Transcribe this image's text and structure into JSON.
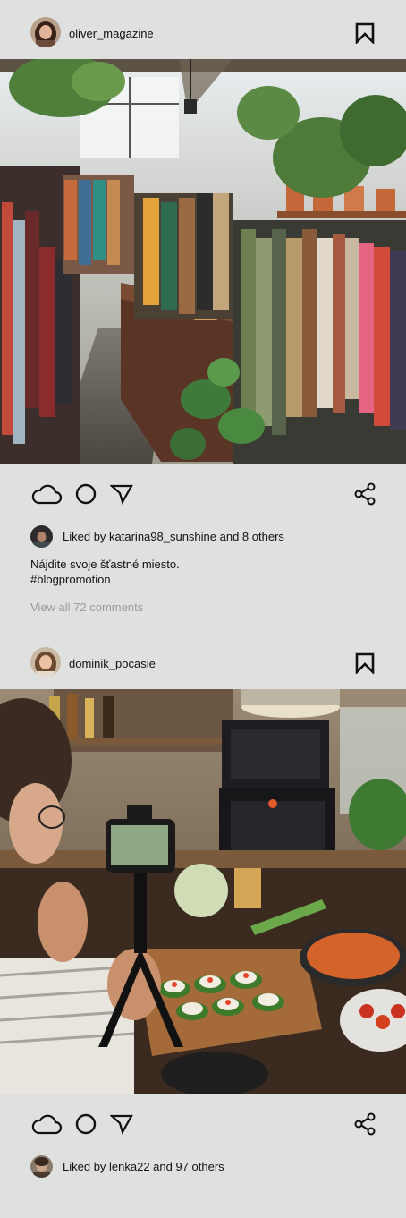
{
  "posts": [
    {
      "username": "oliver_magazine",
      "photo_subject": "vintage-clothing-shop-with-plants",
      "likes_text": "Liked by katarina98_sunshine and 8 others",
      "caption_line1": "Nájdite svoje šťastné miesto.",
      "caption_line2": "#blogpromotion",
      "view_comments": "View all 72 comments"
    },
    {
      "username": "dominik_pocasie",
      "photo_subject": "person-filming-food-spread-with-camera",
      "likes_text": "Liked by lenka22 and 97 others"
    }
  ],
  "icons": {
    "bookmark": "bookmark-icon",
    "like": "cloud-icon",
    "comment": "circle-icon",
    "send": "send-icon",
    "share": "share-icon"
  },
  "colors": {
    "background": "#dfe1e0",
    "text": "#111111",
    "muted": "#9a9c9c"
  }
}
